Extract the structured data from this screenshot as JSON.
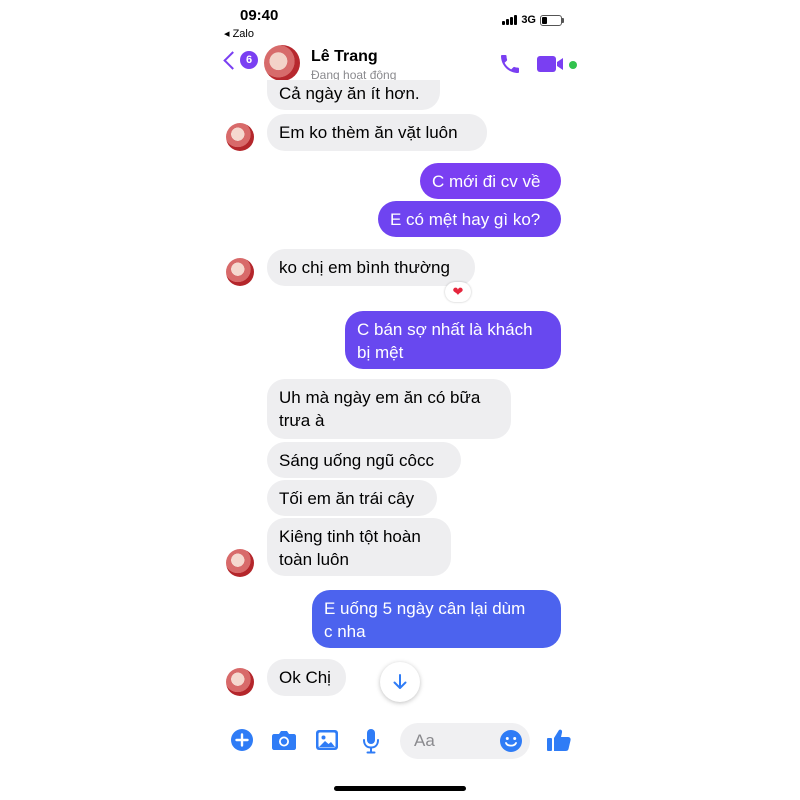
{
  "status_bar": {
    "time": "09:40",
    "back_app": "◂ Zalo",
    "network": "3G"
  },
  "header": {
    "back_badge": "6",
    "contact_name": "Lê Trang",
    "contact_status": "Đang hoạt động"
  },
  "messages": [
    {
      "side": "in",
      "text": "Cả ngày ăn ít hơn."
    },
    {
      "side": "in",
      "text": "Em ko thèm ăn vặt luôn"
    },
    {
      "side": "out",
      "text": "C mới đi cv về"
    },
    {
      "side": "out",
      "text": "E có mệt hay gì ko?"
    },
    {
      "side": "in",
      "text": "ko chị em bình thường",
      "reaction": "❤"
    },
    {
      "side": "out",
      "text": "C bán sợ nhất là khách\nbị mệt"
    },
    {
      "side": "in",
      "text": "Uh mà ngày em ăn có bữa\ntrưa à"
    },
    {
      "side": "in",
      "text": "Sáng uống ngũ côcc"
    },
    {
      "side": "in",
      "text": "Tối em ăn trái cây"
    },
    {
      "side": "in",
      "text": "Kiêng tinh tột hoàn\ntoàn luôn"
    },
    {
      "side": "out",
      "text": "E uống 5 ngày cân lại dùm\nc nha"
    },
    {
      "side": "in",
      "text": "Ok Chị"
    }
  ],
  "composer": {
    "placeholder": "Aa"
  },
  "colors": {
    "accent": "#7a3ff2",
    "out_bubble_purple": "#7a3ff2",
    "out_bubble_blue": "#4c63ee",
    "in_bubble": "#eeeef0",
    "online": "#31c24d",
    "composer_icon": "#2f7cf6"
  },
  "icons": [
    "back-chevron-icon",
    "phone-icon",
    "video-camera-icon",
    "arrow-down-icon",
    "plus-circle-icon",
    "camera-icon",
    "image-icon",
    "microphone-icon",
    "smiley-icon",
    "thumbs-up-icon"
  ]
}
